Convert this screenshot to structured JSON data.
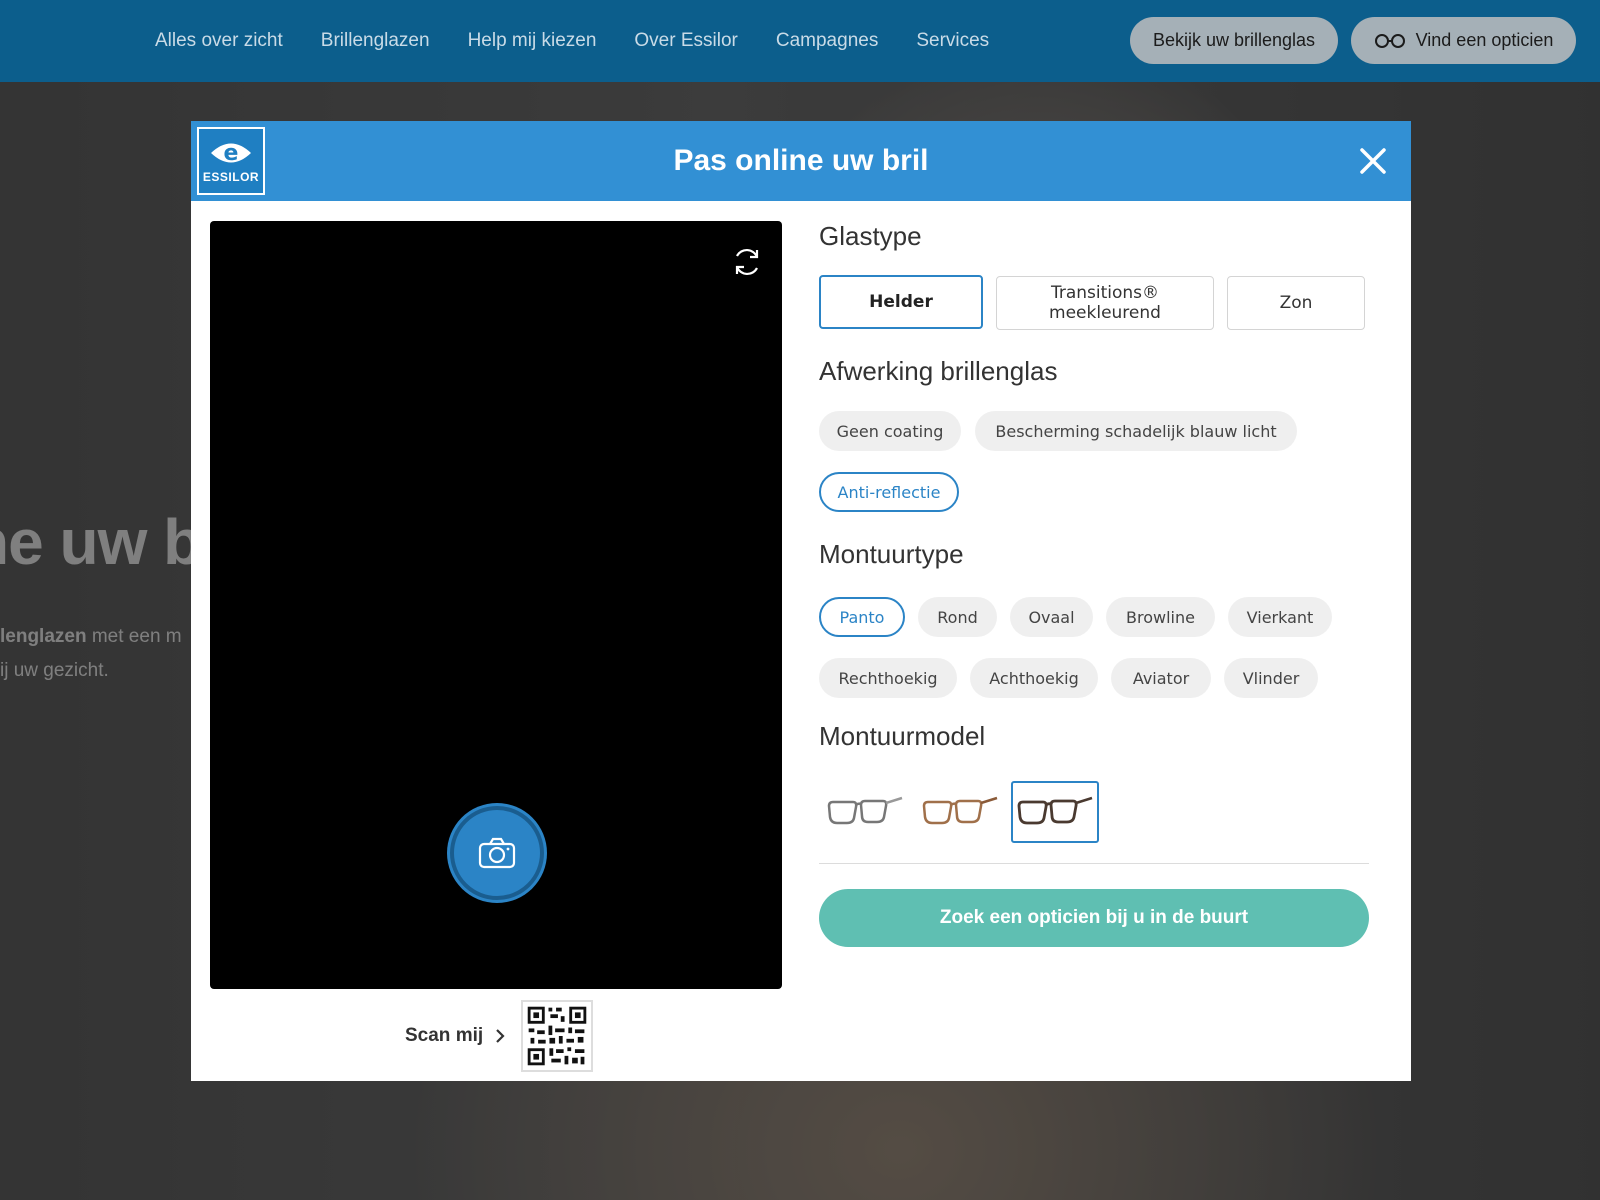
{
  "nav": {
    "links": [
      "Alles over zicht",
      "Brillenglazen",
      "Help mij kiezen",
      "Over Essilor",
      "Campagnes",
      "Services"
    ],
    "buttons": {
      "view_lens": "Bekijk uw brillenglas",
      "find_optician": "Vind een opticien"
    }
  },
  "background": {
    "hero_fragment": "ne uw b",
    "text_line1_bold": "lenglazen",
    "text_line1_rest": " met een m",
    "text_line2": "ij uw gezicht."
  },
  "modal": {
    "logo_text": "ESSILOR",
    "title": "Pas online uw bril",
    "icons": {
      "close": "close-icon",
      "refresh": "refresh-icon",
      "camera": "camera-icon",
      "chevron": "chevron-right-icon",
      "qr": "qr-code-icon"
    },
    "scan_label": "Scan mij",
    "glastype": {
      "title": "Glastype",
      "options": [
        "Helder",
        "Transitions® meekleurend",
        "Zon"
      ],
      "selected": "Helder"
    },
    "afwerking": {
      "title": "Afwerking brillenglas",
      "options": [
        "Geen coating",
        "Bescherming schadelijk blauw licht",
        "Anti-reflectie"
      ],
      "selected": "Anti-reflectie"
    },
    "montuurtype": {
      "title": "Montuurtype",
      "options": [
        "Panto",
        "Rond",
        "Ovaal",
        "Browline",
        "Vierkant",
        "Rechthoekig",
        "Achthoekig",
        "Aviator",
        "Vlinder"
      ],
      "selected": "Panto"
    },
    "montuurmodel": {
      "title": "Montuurmodel",
      "models": [
        "grey-frame",
        "tortoise-frame",
        "dark-frame"
      ],
      "selected_index": 2
    },
    "cta": "Zoek een opticien bij u in de buurt"
  },
  "colors": {
    "nav_bg": "#0c5e8c",
    "header_bg": "#3290d4",
    "accent": "#2b84c6",
    "cta": "#5fbfb2"
  }
}
